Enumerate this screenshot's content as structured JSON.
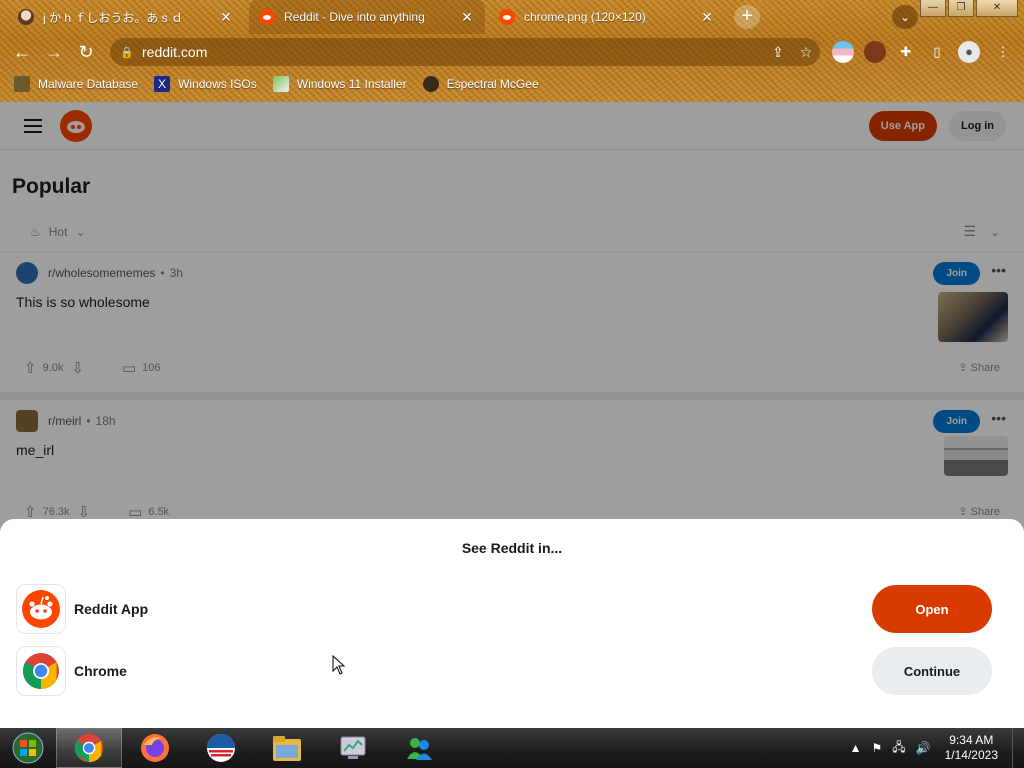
{
  "browser": {
    "tabs": [
      {
        "title": "j か h ｆしおうお。あ s ｄ",
        "active": false
      },
      {
        "title": "Reddit - Dive into anything",
        "active": true
      },
      {
        "title": "chrome.png (120×120)",
        "active": false
      }
    ],
    "new_tab_symbol": "+",
    "tab_close_symbol": "✕",
    "url": "reddit.com",
    "bookmarks": [
      {
        "label": "Malware Database",
        "icon": "folder-icon"
      },
      {
        "label": "Windows ISOs",
        "icon": "x-logo-icon"
      },
      {
        "label": "Windows 11 Installer",
        "icon": "image-icon"
      },
      {
        "label": "Espectral McGee",
        "icon": "avatar-icon"
      }
    ]
  },
  "reddit": {
    "header": {
      "use_app": "Use App",
      "login": "Log in"
    },
    "page_title": "Popular",
    "sort": {
      "label": "Hot"
    },
    "posts": [
      {
        "subreddit": "r/wholesomememes",
        "age": "3h",
        "title": "This is so wholesome",
        "join": "Join",
        "upvotes": "9.0k",
        "comments": "106",
        "share": "Share"
      },
      {
        "subreddit": "r/meirl",
        "age": "18h",
        "title": "me_irl",
        "join": "Join",
        "upvotes": "76.3k",
        "comments": "6.5k",
        "share": "Share"
      }
    ]
  },
  "sheet": {
    "title": "See Reddit in...",
    "options": [
      {
        "label": "Reddit App",
        "button": "Open"
      },
      {
        "label": "Chrome",
        "button": "Continue"
      }
    ]
  },
  "taskbar": {
    "time": "9:34 AM",
    "date": "1/14/2023"
  },
  "colors": {
    "reddit_orange": "#d93a00",
    "join_blue": "#0079d3",
    "snoo": "#ff4500"
  }
}
